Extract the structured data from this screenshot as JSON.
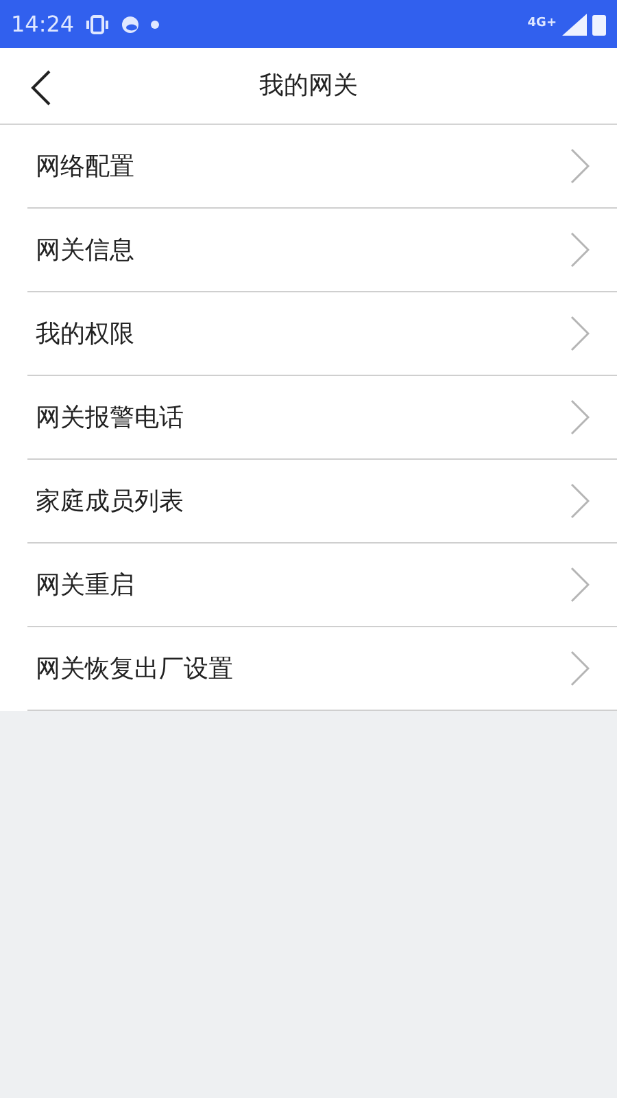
{
  "status_bar": {
    "time": "14:24",
    "network": "4G+"
  },
  "header": {
    "title": "我的网关"
  },
  "menu_items": [
    {
      "label": "网络配置"
    },
    {
      "label": "网关信息"
    },
    {
      "label": "我的权限"
    },
    {
      "label": "网关报警电话"
    },
    {
      "label": "家庭成员列表"
    },
    {
      "label": "网关重启"
    },
    {
      "label": "网关恢复出厂设置"
    }
  ]
}
